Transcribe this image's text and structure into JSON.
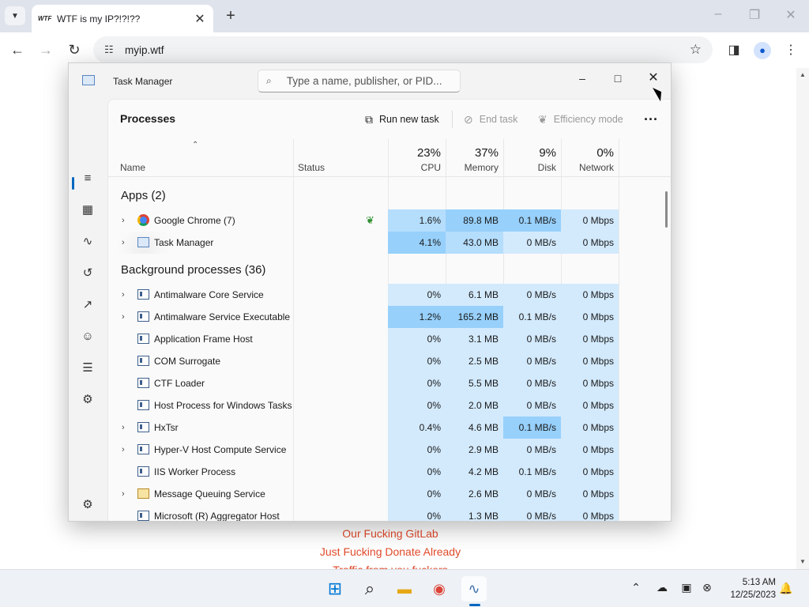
{
  "browser": {
    "tab_title": "WTF is my IP?!?!??",
    "tab_favicon_text": "WTF",
    "url": "myip.wtf",
    "page_links": [
      "Our Fucking GitLab",
      "Just Fucking Donate Already",
      "Traffic from you fuckers"
    ]
  },
  "task_manager": {
    "window_title": "Task Manager",
    "search_placeholder": "Type a name, publisher, or PID...",
    "page_title": "Processes",
    "commands": {
      "run_new_task": "Run new task",
      "end_task": "End task",
      "efficiency_mode": "Efficiency mode",
      "more": "..."
    },
    "columns": {
      "name": "Name",
      "status": "Status",
      "cpu": "CPU",
      "cpu_pct": "23%",
      "memory": "Memory",
      "memory_pct": "37%",
      "disk": "Disk",
      "disk_pct": "9%",
      "network": "Network",
      "network_pct": "0%"
    },
    "groups": {
      "apps": "Apps (2)",
      "background": "Background processes (36)"
    },
    "apps": [
      {
        "name": "Google Chrome (7)",
        "cpu": "1.6%",
        "memory": "89.8 MB",
        "disk": "0.1 MB/s",
        "network": "0 Mbps"
      },
      {
        "name": "Task Manager",
        "cpu": "4.1%",
        "memory": "43.0 MB",
        "disk": "0 MB/s",
        "network": "0 Mbps"
      }
    ],
    "background": [
      {
        "name": "Antimalware Core Service",
        "cpu": "0%",
        "memory": "6.1 MB",
        "disk": "0 MB/s",
        "network": "0 Mbps"
      },
      {
        "name": "Antimalware Service Executable",
        "cpu": "1.2%",
        "memory": "165.2 MB",
        "disk": "0.1 MB/s",
        "network": "0 Mbps"
      },
      {
        "name": "Application Frame Host",
        "cpu": "0%",
        "memory": "3.1 MB",
        "disk": "0 MB/s",
        "network": "0 Mbps"
      },
      {
        "name": "COM Surrogate",
        "cpu": "0%",
        "memory": "2.5 MB",
        "disk": "0 MB/s",
        "network": "0 Mbps"
      },
      {
        "name": "CTF Loader",
        "cpu": "0%",
        "memory": "5.5 MB",
        "disk": "0 MB/s",
        "network": "0 Mbps"
      },
      {
        "name": "Host Process for Windows Tasks",
        "cpu": "0%",
        "memory": "2.0 MB",
        "disk": "0 MB/s",
        "network": "0 Mbps"
      },
      {
        "name": "HxTsr",
        "cpu": "0.4%",
        "memory": "4.6 MB",
        "disk": "0.1 MB/s",
        "network": "0 Mbps"
      },
      {
        "name": "Hyper-V Host Compute Service",
        "cpu": "0%",
        "memory": "2.9 MB",
        "disk": "0 MB/s",
        "network": "0 Mbps"
      },
      {
        "name": "IIS Worker Process",
        "cpu": "0%",
        "memory": "4.2 MB",
        "disk": "0.1 MB/s",
        "network": "0 Mbps"
      },
      {
        "name": "Message Queuing Service",
        "cpu": "0%",
        "memory": "2.6 MB",
        "disk": "0 MB/s",
        "network": "0 Mbps"
      },
      {
        "name": "Microsoft (R) Aggregator Host",
        "cpu": "0%",
        "memory": "1.3 MB",
        "disk": "0 MB/s",
        "network": "0 Mbps"
      }
    ]
  },
  "taskbar": {
    "time": "5:13 AM",
    "date": "12/25/2023"
  },
  "colors": {
    "accent": "#0067c0",
    "heat_low": "#d3eafd",
    "heat_mid": "#b5ddfc",
    "heat_high": "#97d0fb",
    "link": "#e04a2a"
  }
}
